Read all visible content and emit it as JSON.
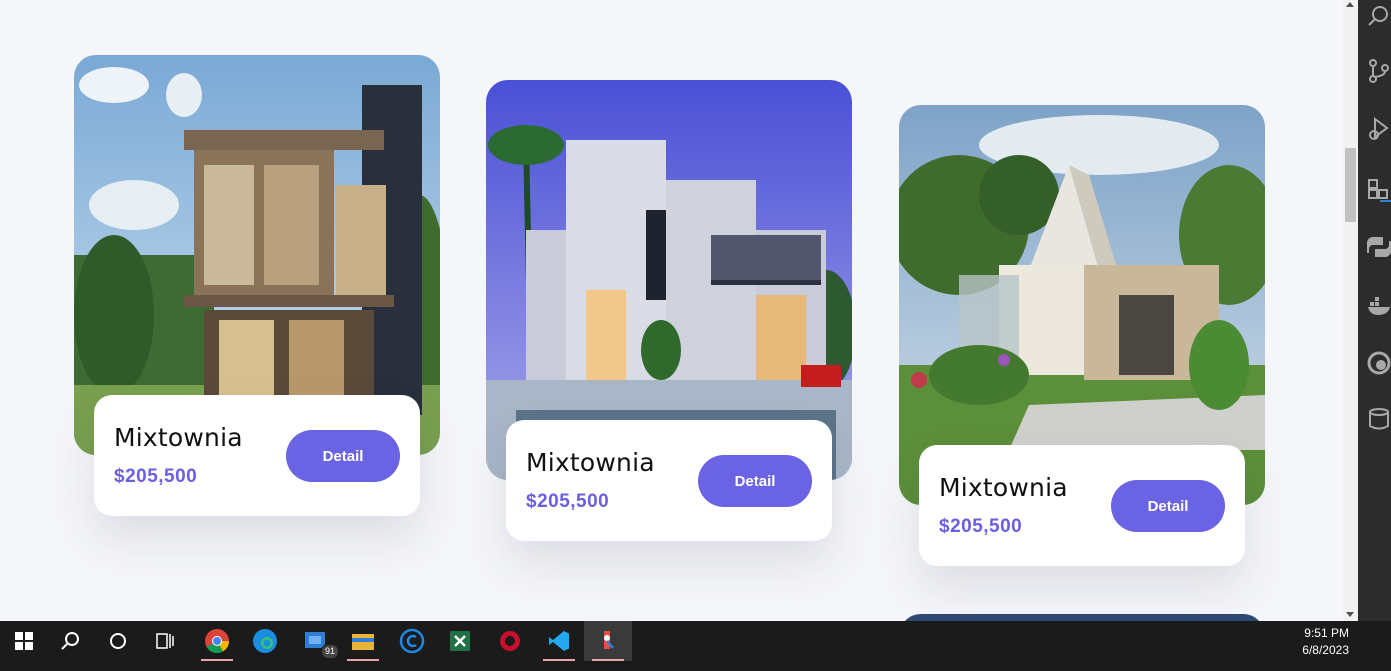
{
  "cards": [
    {
      "name": "Mixtownia",
      "price": "$205,500",
      "button": "Detail"
    },
    {
      "name": "Mixtownia",
      "price": "$205,500",
      "button": "Detail"
    },
    {
      "name": "Mixtownia",
      "price": "$205,500",
      "button": "Detail"
    }
  ],
  "taskbar": {
    "mail_badge": "91",
    "time": "9:51 PM",
    "date": "6/8/2023"
  },
  "colors": {
    "accent": "#6a63e3",
    "price": "#6a5fe0",
    "page_bg": "#f5f6f9"
  },
  "icons": {
    "activity_bar": [
      "search-icon",
      "source-control-icon",
      "run-debug-icon",
      "extensions-icon",
      "python-icon",
      "docker-icon",
      "edge-devtools-icon",
      "database-icon"
    ],
    "taskbar": [
      "windows-start-icon",
      "search-icon",
      "cortana-icon",
      "task-view-icon",
      "chrome-icon",
      "edge-icon",
      "mail-icon",
      "file-explorer-icon",
      "ccleaner-icon",
      "excel-icon",
      "app-icon",
      "vscode-icon",
      "git-icon"
    ]
  }
}
